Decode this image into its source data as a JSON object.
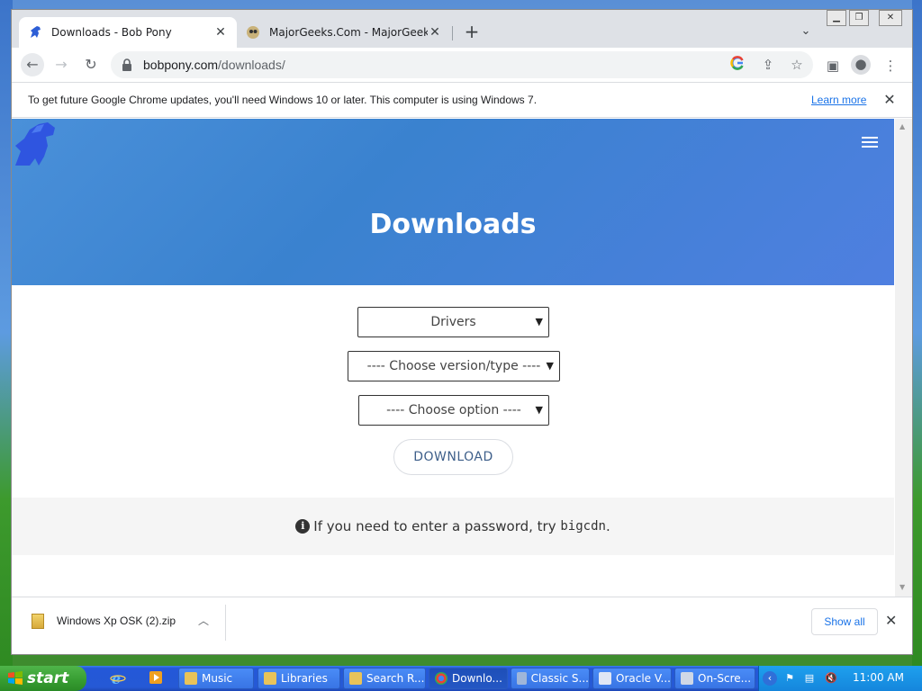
{
  "tabs": [
    {
      "title": "Downloads - Bob Pony",
      "active": true
    },
    {
      "title": "MajorGeeks.Com - MajorGeeks",
      "active": false
    }
  ],
  "toolbar": {
    "url_host": "bobpony.com",
    "url_path": "/downloads/"
  },
  "infobar": {
    "message": "To get future Google Chrome updates, you'll need Windows 10 or later. This computer is using Windows 7.",
    "learn_more": "Learn more"
  },
  "page": {
    "heading": "Downloads",
    "select_category": "Drivers",
    "select_version": "---- Choose version/type ----",
    "select_option": "---- Choose option ----",
    "download_button": "DOWNLOAD",
    "note_prefix": "If you need to enter a password, try",
    "note_code": "bigcdn",
    "note_suffix": "."
  },
  "download_shelf": {
    "file_name": "Windows Xp OSK (2).zip",
    "show_all": "Show all"
  },
  "taskbar": {
    "start_label": "start",
    "buttons": [
      {
        "label": "Music",
        "active": false
      },
      {
        "label": "Libraries",
        "active": false
      },
      {
        "label": "Search R...",
        "active": false
      },
      {
        "label": "Downlo...",
        "active": true
      },
      {
        "label": "Classic S...",
        "active": false
      },
      {
        "label": "Oracle V...",
        "active": false
      },
      {
        "label": "On-Scre...",
        "active": false
      }
    ],
    "clock": "11:00 AM"
  },
  "colors": {
    "hero_blue": "#3a82cf",
    "link_blue": "#1a73e8",
    "taskbar_blue": "#2559d5",
    "start_green": "#369c31"
  }
}
